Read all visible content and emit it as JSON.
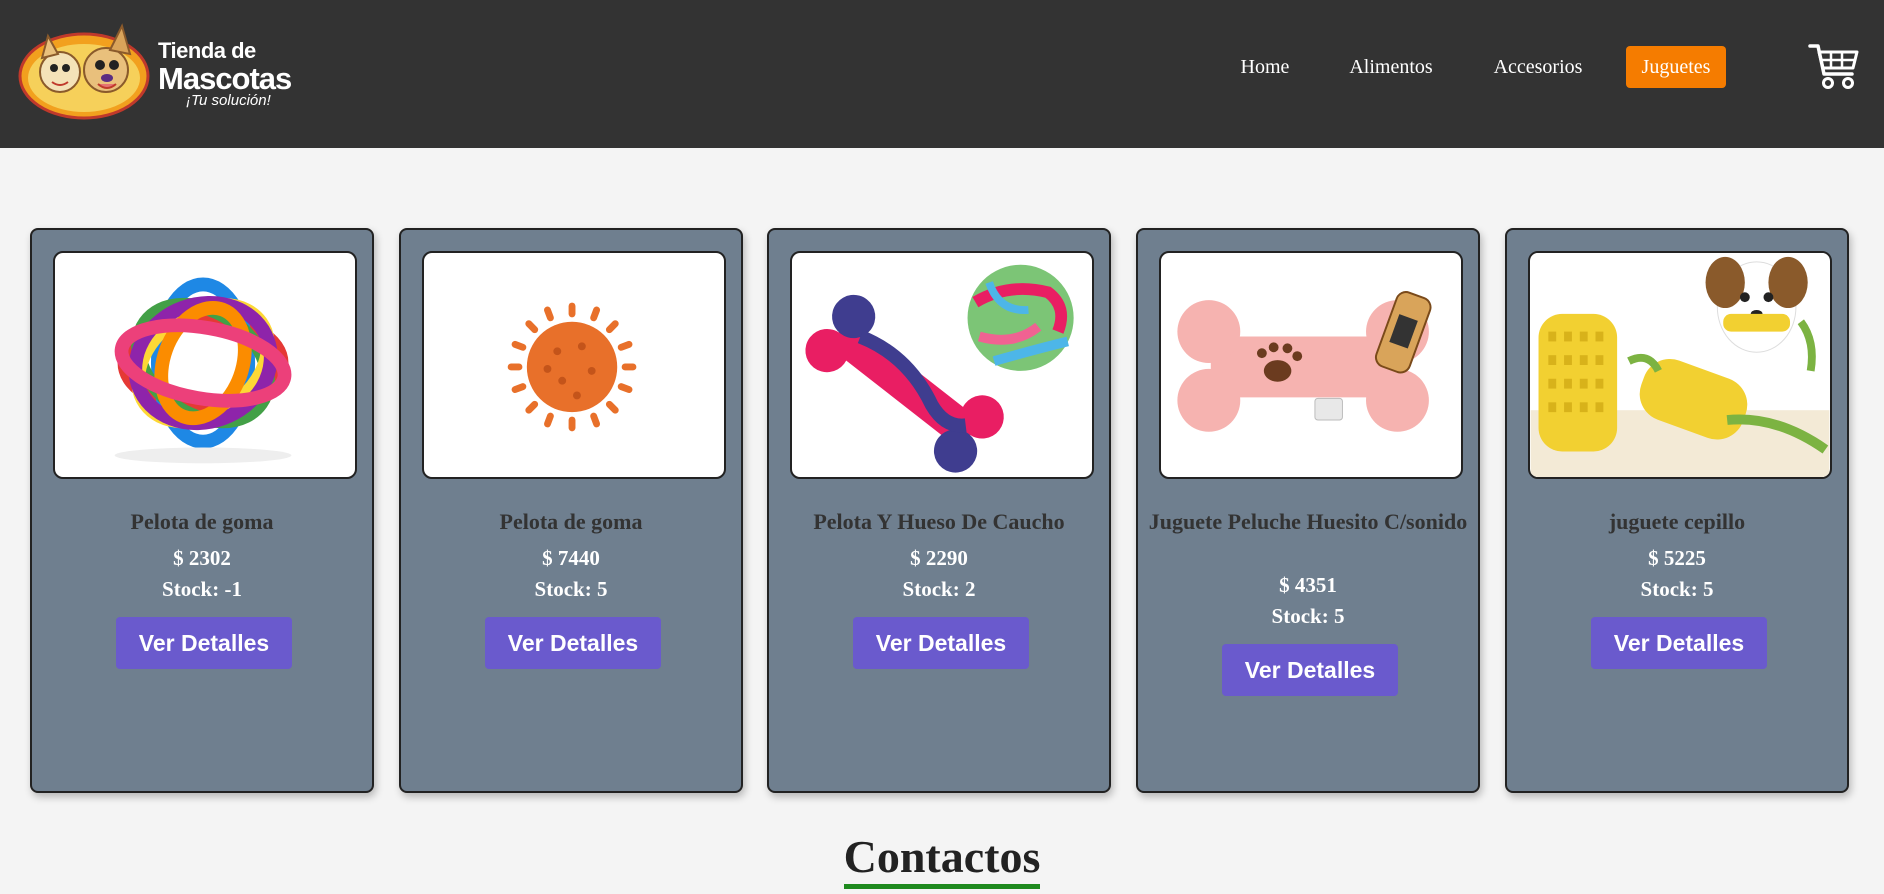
{
  "brand": {
    "line1": "Tienda de",
    "line2": "Mascotas",
    "tagline": "¡Tu solución!"
  },
  "nav": {
    "home": "Home",
    "alimentos": "Alimentos",
    "accesorios": "Accesorios",
    "juguetes": "Juguetes",
    "active": "Juguetes"
  },
  "colors": {
    "header": "#333333",
    "accent": "#f57c00",
    "card": "#6f7f8f",
    "button": "#6a5acd",
    "underline": "#1e8a1e"
  },
  "products": [
    {
      "title": "Pelota de goma",
      "price": "$ 2302",
      "stock": "Stock: -1",
      "button": "Ver Detalles",
      "image": "colorful-ring-ball"
    },
    {
      "title": "Pelota de goma",
      "price": "$ 7440",
      "stock": "Stock: 5",
      "button": "Ver Detalles",
      "image": "orange-spiky-ball"
    },
    {
      "title": "Pelota Y Hueso De Caucho",
      "price": "$ 2290",
      "stock": "Stock: 2",
      "button": "Ver Detalles",
      "image": "rubber-bone-and-ball"
    },
    {
      "title": "Juguete Peluche Huesito C/sonido",
      "price": "$ 4351",
      "stock": "Stock: 5",
      "button": "Ver Detalles",
      "image": "pink-plush-bone"
    },
    {
      "title": "juguete cepillo",
      "price": "$ 5225",
      "stock": "Stock: 5",
      "button": "Ver Detalles",
      "image": "corn-brush-toy-with-dog"
    }
  ],
  "contact": {
    "title": "Contactos"
  }
}
